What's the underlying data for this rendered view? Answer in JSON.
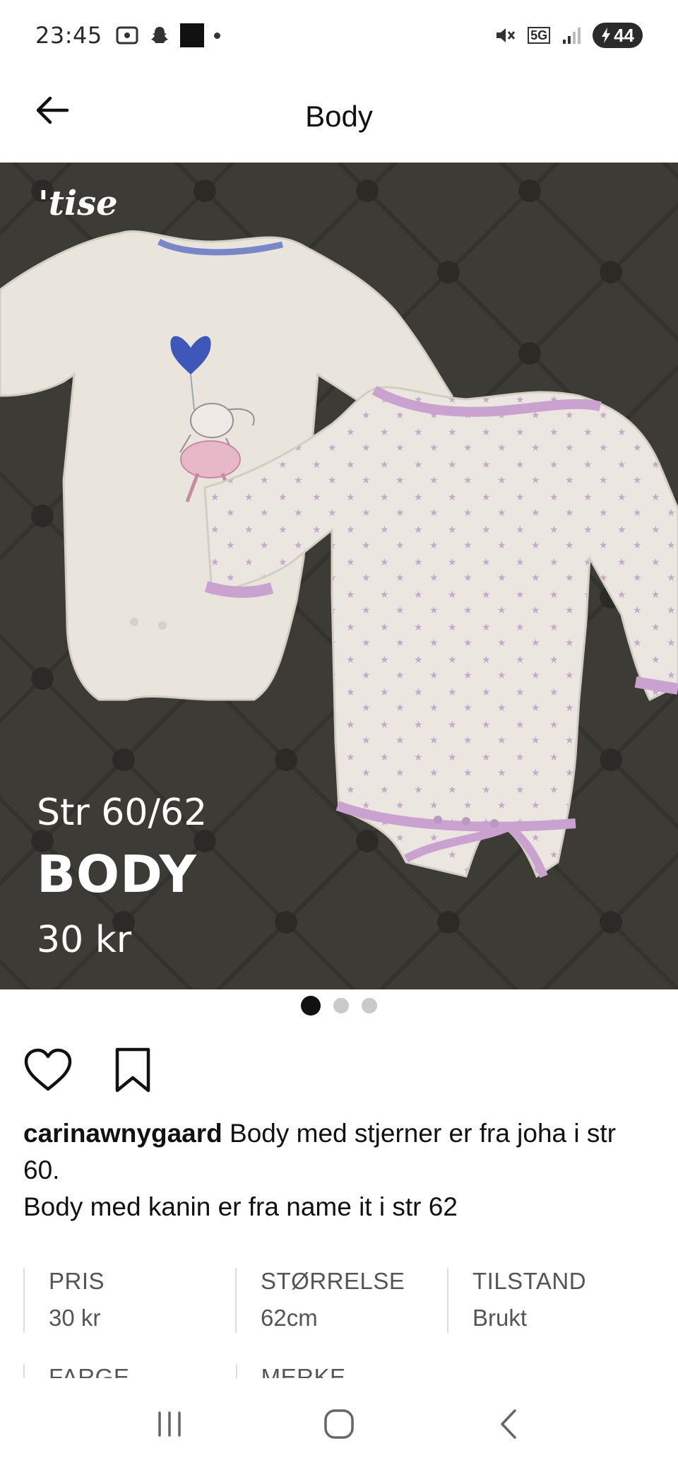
{
  "status_bar": {
    "time": "23:45",
    "icons_left": [
      "screenshot-icon",
      "snapchat-icon",
      "app-icon",
      "dot-icon"
    ],
    "icons_right": [
      "mute-icon",
      "5g-icon",
      "signal-icon",
      "battery-charging-icon"
    ],
    "network_label": "5G",
    "battery_level": "44"
  },
  "header": {
    "title": "Body",
    "back_icon": "arrow-left-icon"
  },
  "hero": {
    "watermark": "'tise",
    "overlay_size": "Str 60/62",
    "overlay_title": "BODY",
    "overlay_price": "30 kr",
    "image_count": 3,
    "active_index": 0,
    "colors": {
      "background": "#3d3b35",
      "garment": "#ece6e0",
      "trim": "#c9a2cf"
    }
  },
  "actions": {
    "like_icon": "heart-outline-icon",
    "save_icon": "bookmark-outline-icon"
  },
  "caption": {
    "username": "carinawnygaard",
    "line1": "Body med stjerner er fra joha i str 60.",
    "line2": "Body med kanin er fra name it i str 62"
  },
  "specs": [
    {
      "label": "PRIS",
      "value": "30 kr"
    },
    {
      "label": "STØRRELSE",
      "value": "62cm"
    },
    {
      "label": "TILSTAND",
      "value": "Brukt"
    }
  ],
  "specs_row2": [
    {
      "label": "FARGE"
    },
    {
      "label": "MERKE"
    }
  ],
  "nav_bar": {
    "recents_icon": "recents-icon",
    "home_icon": "home-icon",
    "back_icon": "back-chevron-icon"
  }
}
